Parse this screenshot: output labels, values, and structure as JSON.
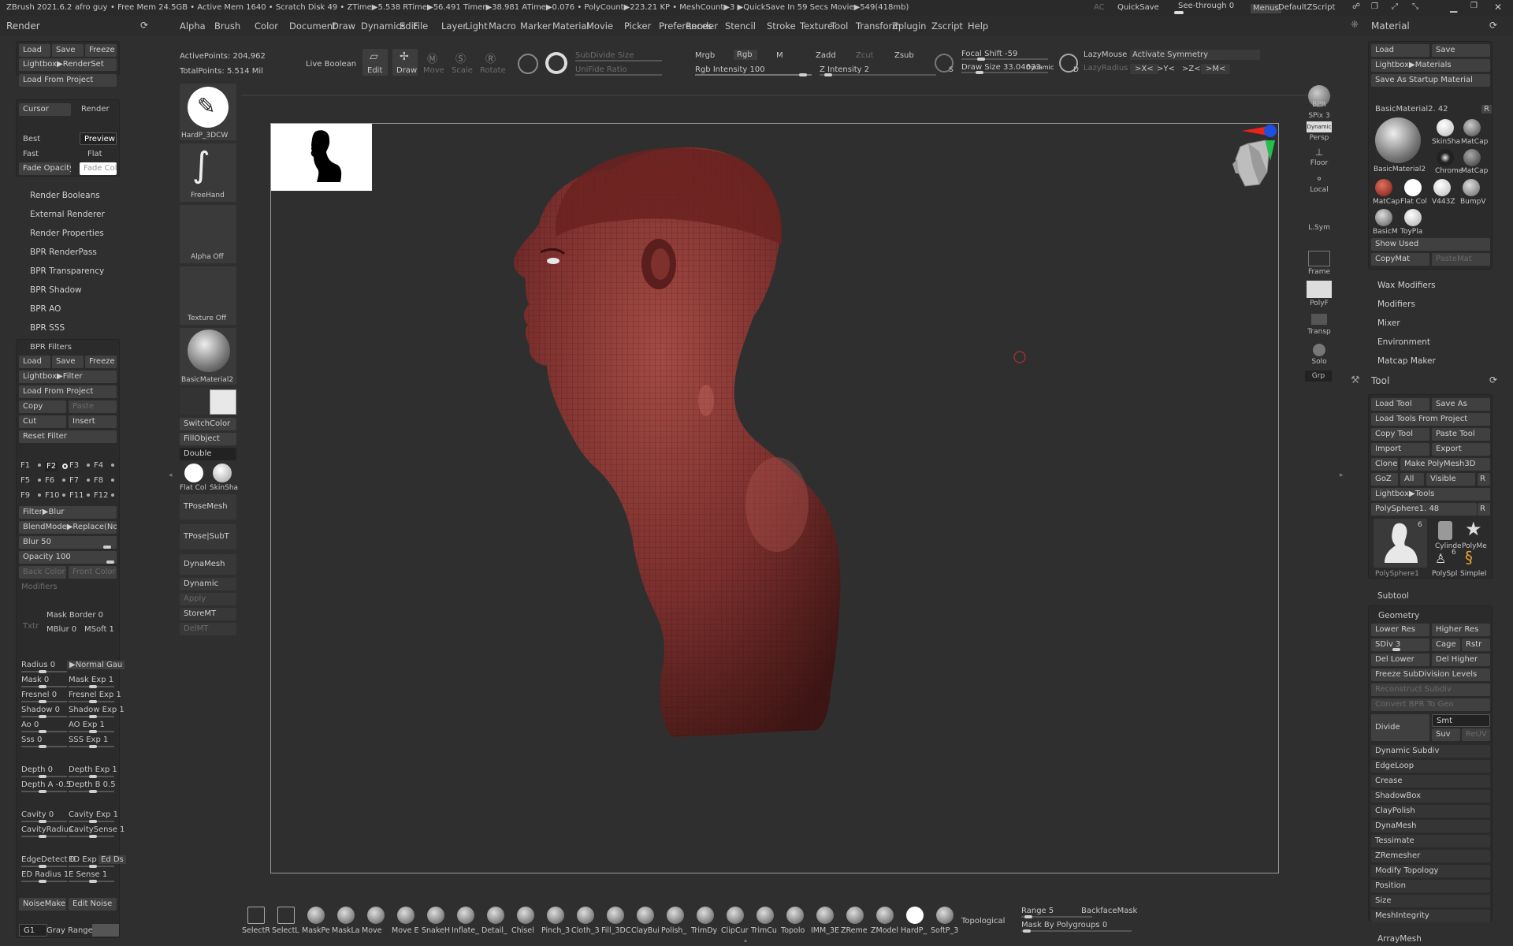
{
  "titlebar": {
    "app": "ZBrush 2021.6.2",
    "doc": "afro guy",
    "stats": "•  Free Mem 24.5GB • Active Mem 1640 • Scratch Disk 49 •  ZTime▶5.538 RTime▶56.491 Timer▶38.981 ATime▶0.076 • PolyCount▶223.21 KP  • MeshCount▶3  ▶QuickSave In 59 Secs Movie▶549(418mb)",
    "ac": "AC",
    "quicksave": "QuickSave",
    "seethrough": "See-through  0",
    "menus": "Menus",
    "script": "DefaultZScript"
  },
  "menus": [
    "Alpha",
    "Brush",
    "Color",
    "Document",
    "Draw",
    "Dynamics",
    "Edit",
    "File",
    "Layer",
    "Light",
    "Macro",
    "Marker",
    "Material",
    "Movie",
    "Picker",
    "Preferences",
    "Render",
    "Stencil",
    "Stroke",
    "Texture",
    "Tool",
    "Transform",
    "Zplugin",
    "Zscript",
    "Help"
  ],
  "topbar": {
    "active_points": "ActivePoints: 204,962",
    "total_points": "TotalPoints: 5.514 Mil",
    "live_boolean": "Live Boolean",
    "edit": "Edit",
    "draw": "Draw",
    "move": "Move",
    "scale": "Scale",
    "rotate": "Rotate",
    "subdivide_size": "SubDivide Size",
    "unifide_ratio": "UniFide Ratio",
    "mrgb": "Mrgb",
    "rgb": "Rgb",
    "m": "M",
    "rgb_intensity": "Rgb Intensity 100",
    "zadd": "Zadd",
    "zcut": "Zcut",
    "zsub": "Zsub",
    "z_intensity": "Z Intensity 2",
    "focal_shift": "Focal Shift -59",
    "draw_size": "Draw Size 33.04633",
    "dynamic": "Dynamic",
    "lazymouse": "LazyMouse",
    "lazyradius": "LazyRadius",
    "activate_symmetry": "Activate Symmetry",
    "sym_x": ">X<",
    "sym_y": ">Y<",
    "sym_z": ">Z<",
    "sym_m": ">M<"
  },
  "render_panel": {
    "title": "Render",
    "load": "Load",
    "save": "Save",
    "freeze": "Freeze",
    "lightbox": "Lightbox▶RenderSet",
    "load_project": "Load From Project",
    "cursor": "Cursor",
    "render": "Render",
    "best": "Best",
    "preview": "Preview",
    "fast": "Fast",
    "flat": "Flat",
    "fade_opacity": "Fade Opacity",
    "fade_color": "Fade Color",
    "sections": [
      "Render Booleans",
      "External Renderer",
      "Render Properties",
      "BPR RenderPass",
      "BPR Transparency",
      "BPR Shadow",
      "BPR AO",
      "BPR SSS"
    ],
    "filters_title": "BPR Filters",
    "f_load": "Load",
    "f_save": "Save",
    "f_freeze": "Freeze",
    "f_lightbox": "Lightbox▶Filter",
    "f_load_project": "Load From Project",
    "copy": "Copy",
    "paste": "Paste",
    "cut": "Cut",
    "insert": "Insert",
    "reset": "Reset Filter",
    "slots": [
      "F1",
      "F2",
      "F3",
      "F4",
      "F5",
      "F6",
      "F7",
      "F8",
      "F9",
      "F10",
      "F11",
      "F12"
    ],
    "filter_blur": "Filter▶Blur",
    "blendmode": "BlendMode▶Replace(Normal)",
    "blur": "Blur 50",
    "opacity": "Opacity 100",
    "back_color": "Back Color",
    "front_color": "Front Color",
    "modifiers": "Modifiers",
    "txtr": "Txtr",
    "mask_border": "Mask Border 0",
    "mblur": "MBlur 0",
    "msoft": "MSoft 1",
    "radius": "Radius 0",
    "normal_gau": "▶Normal Gau",
    "mask": "Mask 0",
    "mask_exp": "Mask Exp 1",
    "fresnel": "Fresnel 0",
    "fresnel_exp": "Fresnel Exp 1",
    "shadow": "Shadow 0",
    "shadow_exp": "Shadow Exp 1",
    "ao": "Ao 0",
    "ao_exp": "AO Exp 1",
    "sss": "Sss 0",
    "sss_exp": "SSS Exp 1",
    "depth": "Depth 0",
    "depth_exp": "Depth Exp 1",
    "depth_a": "Depth A -0.5",
    "depth_b": "Depth B 0.5",
    "cavity": "Cavity 0",
    "cavity_exp": "Cavity Exp 1",
    "cavity_radius": "CavityRadius",
    "cavity_sense": "CavitySense 1",
    "edge_detect": "EdgeDetect 0",
    "ed_exp": "ED Exp",
    "ed_ds": "Ed Ds",
    "ed_radius": "ED Radius 1",
    "e_sense": "E Sense 1",
    "noisemaker": "NoiseMaker",
    "edit_noise": "Edit Noise",
    "g1": "G1",
    "gray_range": "Gray Range 0"
  },
  "shelf": {
    "brush1": "HardP_3DCW",
    "brush2": "FreeHand",
    "alpha": "Alpha Off",
    "texture": "Texture Off",
    "material": "BasicMaterial2",
    "switchcolor": "SwitchColor",
    "fillobject": "FillObject",
    "double": "Double",
    "flatcol": "Flat Col",
    "skinsha": "SkinSha",
    "tposemesh": "TPoseMesh",
    "tposesubt": "TPose|SubT",
    "dynamesh": "DynaMesh",
    "dynamic": "Dynamic",
    "apply": "Apply",
    "storemt": "StoreMT",
    "delmt": "DelMT"
  },
  "rightshelf": {
    "bpr": "BPR",
    "spix": "SPix 3",
    "dynamic": "Dynamic",
    "persp": "Persp",
    "floor": "Floor",
    "local": "Local",
    "lsym": "L.Sym",
    "frame": "Frame",
    "polyf": "PolyF",
    "transp": "Transp",
    "solo": "Solo",
    "grp": "Grp"
  },
  "material_panel": {
    "title": "Material",
    "load": "Load",
    "save": "Save",
    "lightbox": "Lightbox▶Materials",
    "startup": "Save As Startup Material",
    "current": "BasicMaterial2. 42",
    "r": "R",
    "m1": "SkinSha",
    "m2": "MatCap",
    "m3": "BasicMaterial2",
    "m4": "Chrome",
    "m5": "MatCap",
    "m6": "MatCap",
    "m7": "Flat Col",
    "m8": "V443Z",
    "m9": "BumpV",
    "m10": "BasicM",
    "m11": "ToyPla",
    "show_used": "Show Used",
    "copymat": "CopyMat",
    "pastemat": "PasteMat",
    "sections": [
      "Wax Modifiers",
      "Modifiers",
      "Mixer",
      "Environment",
      "Matcap Maker"
    ]
  },
  "tool_panel": {
    "title": "Tool",
    "load_tool": "Load Tool",
    "save_as": "Save As",
    "load_tools_project": "Load Tools From Project",
    "copy_tool": "Copy Tool",
    "paste_tool": "Paste Tool",
    "import": "Import",
    "export": "Export",
    "clone": "Clone",
    "make_polymesh": "Make PolyMesh3D",
    "goz": "GoZ",
    "all": "All",
    "visible": "Visible",
    "r": "R",
    "lightbox_tools": "Lightbox▶Tools",
    "current": "PolySphere1. 48",
    "t1": "PolySphere1",
    "t2": "Cylinde",
    "t3": "PolyMe",
    "t4": "PolySpl",
    "t5": "SimpleI",
    "count1": "6",
    "count2": "6",
    "subtool": "Subtool",
    "geometry": "Geometry",
    "lower_res": "Lower Res",
    "higher_res": "Higher Res",
    "sdiv": "SDiv 3",
    "cage": "Cage",
    "rstr": "Rstr",
    "del_lower": "Del Lower",
    "del_higher": "Del Higher",
    "freeze_sub": "Freeze SubDivision Levels",
    "reconstruct": "Reconstruct Subdiv",
    "convert_bpr": "Convert BPR To Geo",
    "divide": "Divide",
    "smt": "Smt",
    "suv": "Suv",
    "reuv": "ReUV",
    "sections": [
      "Dynamic Subdiv",
      "EdgeLoop",
      "Crease",
      "ShadowBox",
      "ClayPolish",
      "DynaMesh",
      "Tessimate",
      "ZRemesher",
      "Modify Topology",
      "Position",
      "Size",
      "MeshIntegrity"
    ],
    "arraymesh": "ArrayMesh"
  },
  "bottom": {
    "brushes": [
      "SelectR",
      "SelectL",
      "MaskPe",
      "MaskLa",
      "Move",
      "Move E",
      "SnakeH",
      "Inflate_",
      "Detail_",
      "Chisel",
      "Pinch_3",
      "Cloth_3",
      "Fill_3DC",
      "ClayBui",
      "Polish_",
      "TrimDy",
      "ClipCur",
      "TrimCu",
      "Topolo",
      "IMM_3E",
      "ZReme",
      "ZModel",
      "HardP_",
      "SoftP_3"
    ],
    "topological": "Topological",
    "range": "Range 5",
    "backface": "BackfaceMask",
    "mask_polygroups": "Mask By Polygroups 0"
  },
  "colors": {
    "skin": "#7a2f2d",
    "accent_blue": "#2f6fbf",
    "bg": "#2f2f2f"
  }
}
